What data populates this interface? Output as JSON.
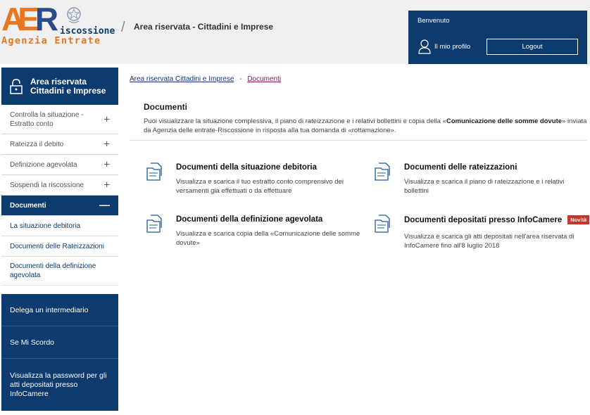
{
  "header": {
    "logo_big": "AER",
    "logo_riscossione": "iscossione",
    "logo_agenzia": "Agenzia Entrate",
    "area_title": "Area riservata - Cittadini e Imprese",
    "welcome": "Benvenuto",
    "profile_label": "Il mio profilo",
    "logout_label": "Logout"
  },
  "sidebar": {
    "title_line1": "Area riservata",
    "title_line2": "Cittadini e Imprese",
    "menu": [
      {
        "label": "Controlla la situazione - Estratto conto",
        "sign": "+"
      },
      {
        "label": "Rateizza il debito",
        "sign": "+"
      },
      {
        "label": "Definizione agevolata",
        "sign": "+"
      },
      {
        "label": "Sospendi la riscossione",
        "sign": "+"
      },
      {
        "label": "Documenti",
        "sign": "—"
      }
    ],
    "submenu": [
      {
        "label": "La situazione debitoria"
      },
      {
        "label": "Documenti delle Rateizzazioni"
      },
      {
        "label": "Documenti della definizione agevolata"
      }
    ],
    "blocks": [
      {
        "label": "Delega un intermediario"
      },
      {
        "label": "Se Mi Scordo"
      },
      {
        "label": "Visualizza la password per gli atti depositati presso InfoCamere"
      }
    ]
  },
  "breadcrumb": {
    "item1": "Area riservata Cittadini e Imprese",
    "separator": "-",
    "item2": "Documenti"
  },
  "main": {
    "title": "Documenti",
    "intro_before": "Puoi visualizzare la situazione complessiva, il piano di rateizzazione e i relativi bollettini e copia della «",
    "intro_bold": "Comunicazione delle somme dovute",
    "intro_after": "» inviata da Agenzia delle entrate-Riscossione in risposta alla tua domanda di «rottamazione».",
    "cards": [
      {
        "title": "Documenti della situazione debitoria",
        "desc": "Visualizza e scarica il tuo estratto conto comprensivo dei versamenti già effettuati o da effettuare"
      },
      {
        "title": "Documenti delle rateizzazioni",
        "desc": "Visualizza e scarica il piano di rateizzazione e i relativi bollettini"
      },
      {
        "title": "Documenti della definizione agevolata",
        "desc": "Visualizza e scarica copia della «Comunicazione delle somme dovute»"
      },
      {
        "title": "Documenti depositati presso InfoCamere",
        "desc": "Visualizza e scarica gli atti depositati nell'area riservata di InfoCamere fino all'8 luglio 2018",
        "badge": "Novità"
      }
    ]
  },
  "colors": {
    "primary": "#0d3b6e",
    "accent": "#e87722",
    "badge": "#c0392b",
    "visited_link": "#7a1a6e"
  },
  "icons": [
    "emblem-icon",
    "user-icon",
    "lock-icon",
    "document-icon"
  ]
}
